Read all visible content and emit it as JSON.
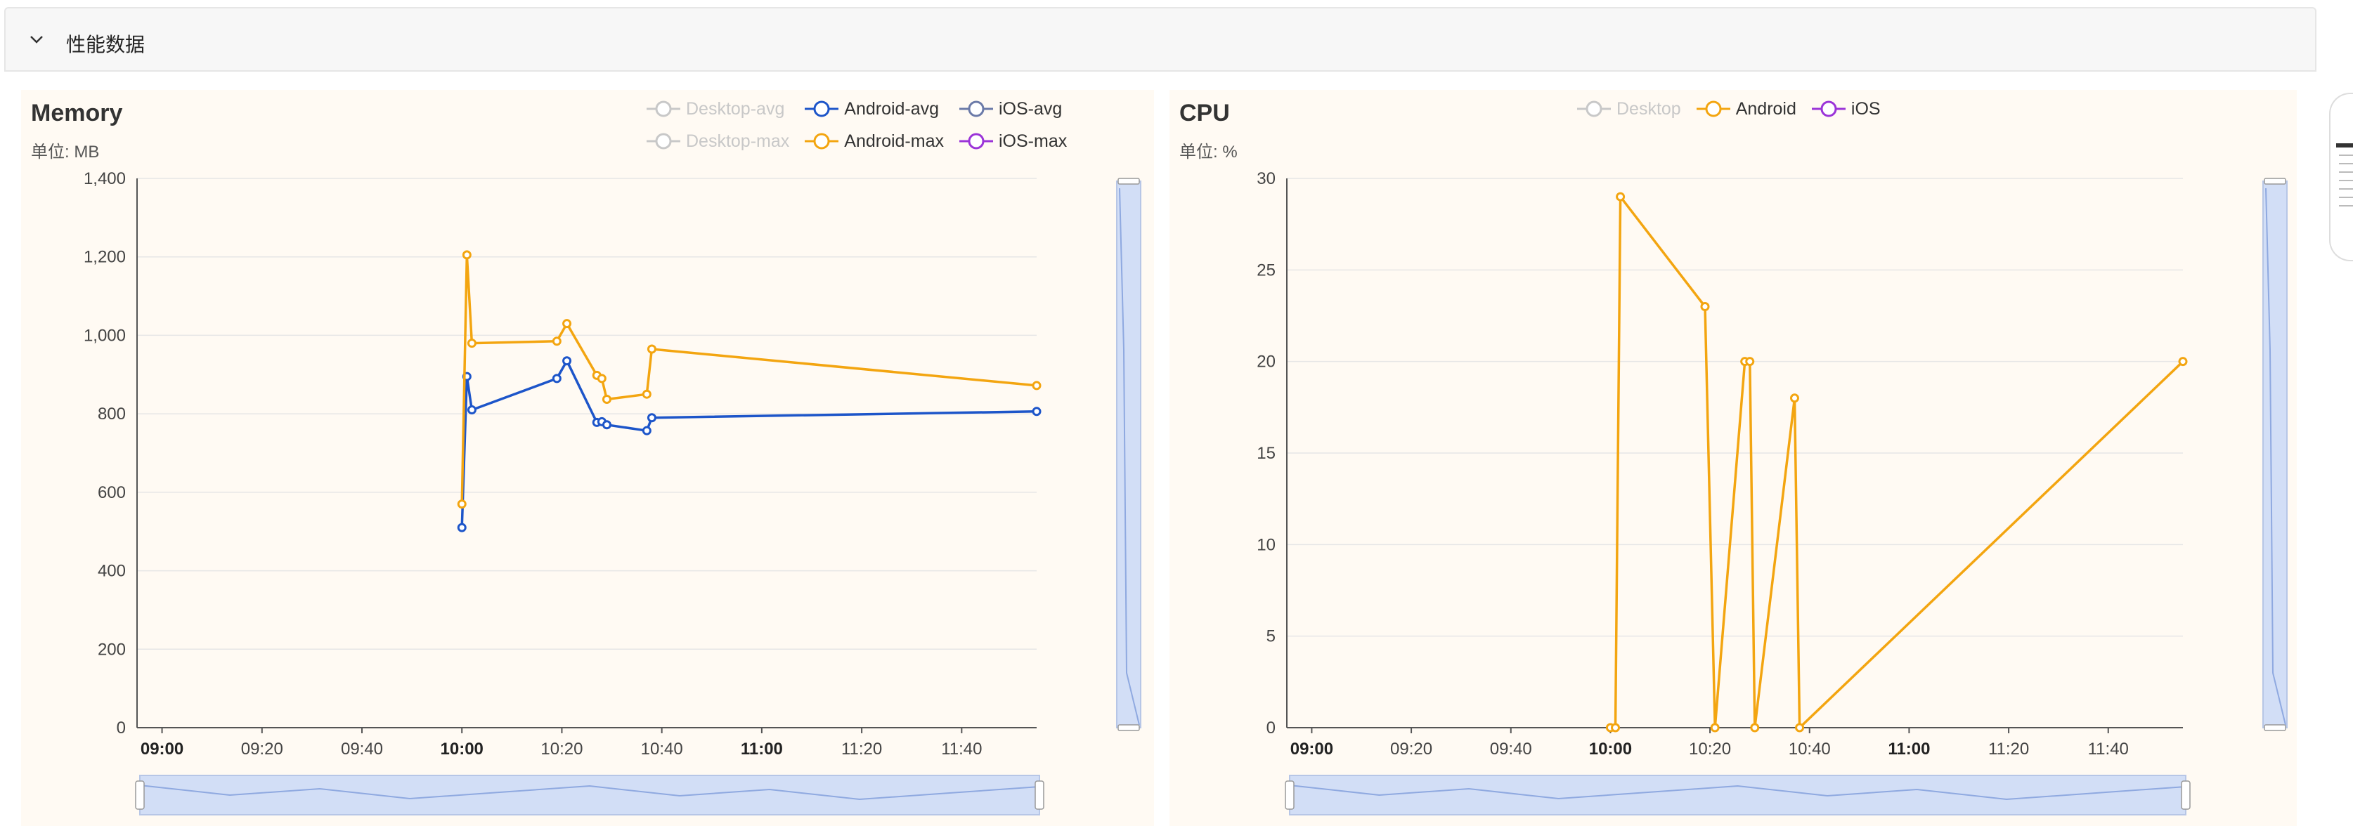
{
  "section": {
    "title": "性能数据"
  },
  "colors": {
    "android_avg": "#1d55c9",
    "android_max": "#f3a510",
    "ios_avg": "#6b7aa8",
    "ios_max": "#9b34d8",
    "desktop_disabled": "#c8c8c8",
    "panel_bg": "#fffaf3",
    "grid": "#e6e6e6",
    "slider_fill": "#d2def6",
    "slider_line": "#8fa9e0"
  },
  "chart_data": [
    {
      "id": "memory",
      "type": "line",
      "title": "Memory",
      "unit_label": "单位: MB",
      "legend": [
        {
          "label": "Desktop-avg",
          "color": "#c8c8c8",
          "disabled": true
        },
        {
          "label": "Android-avg",
          "color": "#1d55c9",
          "disabled": false
        },
        {
          "label": "iOS-avg",
          "color": "#6b7aa8",
          "disabled": false
        },
        {
          "label": "Desktop-max",
          "color": "#c8c8c8",
          "disabled": true
        },
        {
          "label": "Android-max",
          "color": "#f3a510",
          "disabled": false
        },
        {
          "label": "iOS-max",
          "color": "#9b34d8",
          "disabled": false
        }
      ],
      "x_ticks": [
        "09:00",
        "09:20",
        "09:40",
        "10:00",
        "10:20",
        "10:40",
        "11:00",
        "11:20",
        "11:40"
      ],
      "x_ticks_bold": [
        "09:00",
        "10:00",
        "11:00"
      ],
      "x_range": [
        "08:55",
        "11:55"
      ],
      "ylim": [
        0,
        1400
      ],
      "y_ticks": [
        "0",
        "200",
        "400",
        "600",
        "800",
        "1,000",
        "1,200",
        "1,400"
      ],
      "y_tick_values": [
        0,
        200,
        400,
        600,
        800,
        1000,
        1200,
        1400
      ],
      "grid": true,
      "legend_position": "top-right",
      "series": [
        {
          "name": "Android-avg",
          "color": "#1d55c9",
          "x": [
            "10:00",
            "10:01",
            "10:02",
            "10:19",
            "10:21",
            "10:27",
            "10:28",
            "10:29",
            "10:37",
            "10:38",
            "11:55"
          ],
          "values": [
            510,
            895,
            810,
            890,
            935,
            778,
            780,
            772,
            757,
            790,
            806
          ]
        },
        {
          "name": "Android-max",
          "color": "#f3a510",
          "x": [
            "10:00",
            "10:01",
            "10:02",
            "10:19",
            "10:21",
            "10:27",
            "10:28",
            "10:29",
            "10:37",
            "10:38",
            "11:55"
          ],
          "values": [
            570,
            1205,
            980,
            985,
            1030,
            898,
            890,
            837,
            850,
            965,
            872
          ]
        }
      ]
    },
    {
      "id": "cpu",
      "type": "line",
      "title": "CPU",
      "unit_label": "单位: %",
      "legend": [
        {
          "label": "Desktop",
          "color": "#c8c8c8",
          "disabled": true
        },
        {
          "label": "Android",
          "color": "#f3a510",
          "disabled": false
        },
        {
          "label": "iOS",
          "color": "#9b34d8",
          "disabled": false
        }
      ],
      "x_ticks": [
        "09:00",
        "09:20",
        "09:40",
        "10:00",
        "10:20",
        "10:40",
        "11:00",
        "11:20",
        "11:40"
      ],
      "x_ticks_bold": [
        "09:00",
        "10:00",
        "11:00"
      ],
      "x_range": [
        "08:55",
        "11:55"
      ],
      "ylim": [
        0,
        30
      ],
      "y_ticks": [
        "0",
        "5",
        "10",
        "15",
        "20",
        "25",
        "30"
      ],
      "y_tick_values": [
        0,
        5,
        10,
        15,
        20,
        25,
        30
      ],
      "grid": true,
      "legend_position": "top-center",
      "series": [
        {
          "name": "Android",
          "color": "#f3a510",
          "x": [
            "10:00",
            "10:01",
            "10:02",
            "10:19",
            "10:21",
            "10:27",
            "10:28",
            "10:29",
            "10:37",
            "10:38",
            "11:55"
          ],
          "values": [
            0,
            0,
            29,
            23,
            0,
            20,
            20,
            0,
            18,
            0,
            20
          ]
        }
      ]
    }
  ]
}
